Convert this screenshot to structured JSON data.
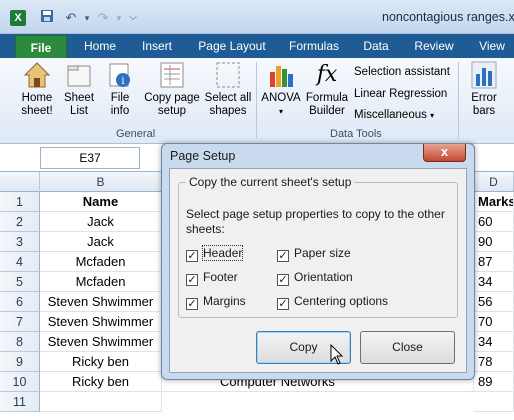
{
  "window": {
    "title": "noncontagious ranges.xl",
    "app_icon": "X"
  },
  "tabs": [
    "File",
    "Home",
    "Insert",
    "Page Layout",
    "Formulas",
    "Data",
    "Review",
    "View"
  ],
  "ribbon": {
    "general": {
      "home_sheet": "Home\nsheet!",
      "sheet_list": "Sheet\nList",
      "file_info": "File\ninfo",
      "copy_page_setup": "Copy page\nsetup",
      "select_all_shapes": "Select all\nshapes",
      "group_label": "General"
    },
    "data_tools": {
      "anova": "ANOVA",
      "formula_builder": "Formula\nBuilder",
      "selection_assistant": "Selection assistant",
      "linear_regression": "Linear Regression",
      "miscellaneous": "Miscellaneous",
      "group_label": "Data Tools"
    },
    "error_bars": "Error\nbars"
  },
  "formula_bar": {
    "name_box": "E37",
    "fx": "fx"
  },
  "sheet": {
    "col_b": "B",
    "col_d": "D",
    "rows": [
      {
        "num": "1",
        "b": "Name",
        "d": "Marks"
      },
      {
        "num": "2",
        "b": "Jack",
        "d": "60"
      },
      {
        "num": "3",
        "b": "Jack",
        "d": "90"
      },
      {
        "num": "4",
        "b": "Mcfaden",
        "d": "87"
      },
      {
        "num": "5",
        "b": "Mcfaden",
        "d": "34"
      },
      {
        "num": "6",
        "b": "Steven Shwimmer",
        "d": "56"
      },
      {
        "num": "7",
        "b": "Steven Shwimmer",
        "d": "70"
      },
      {
        "num": "8",
        "b": "Steven Shwimmer",
        "d": "34"
      },
      {
        "num": "9",
        "b": "Ricky ben",
        "d": "78"
      },
      {
        "num": "10",
        "b": "Ricky ben",
        "d": "89"
      },
      {
        "num": "11",
        "b": "",
        "d": ""
      }
    ],
    "partial_c10": "Computer Networks"
  },
  "dialog": {
    "title": "Page Setup",
    "close_glyph": "x",
    "group_label": "Copy the current sheet's setup",
    "description": "Select page setup properties to copy to the other sheets:",
    "options": [
      {
        "label": "Header",
        "checked": true
      },
      {
        "label": "Paper size",
        "checked": true
      },
      {
        "label": "Footer",
        "checked": true
      },
      {
        "label": "Orientation",
        "checked": true
      },
      {
        "label": "Margins",
        "checked": true
      },
      {
        "label": "Centering options",
        "checked": true
      }
    ],
    "copy_button": "Copy",
    "close_button": "Close"
  }
}
